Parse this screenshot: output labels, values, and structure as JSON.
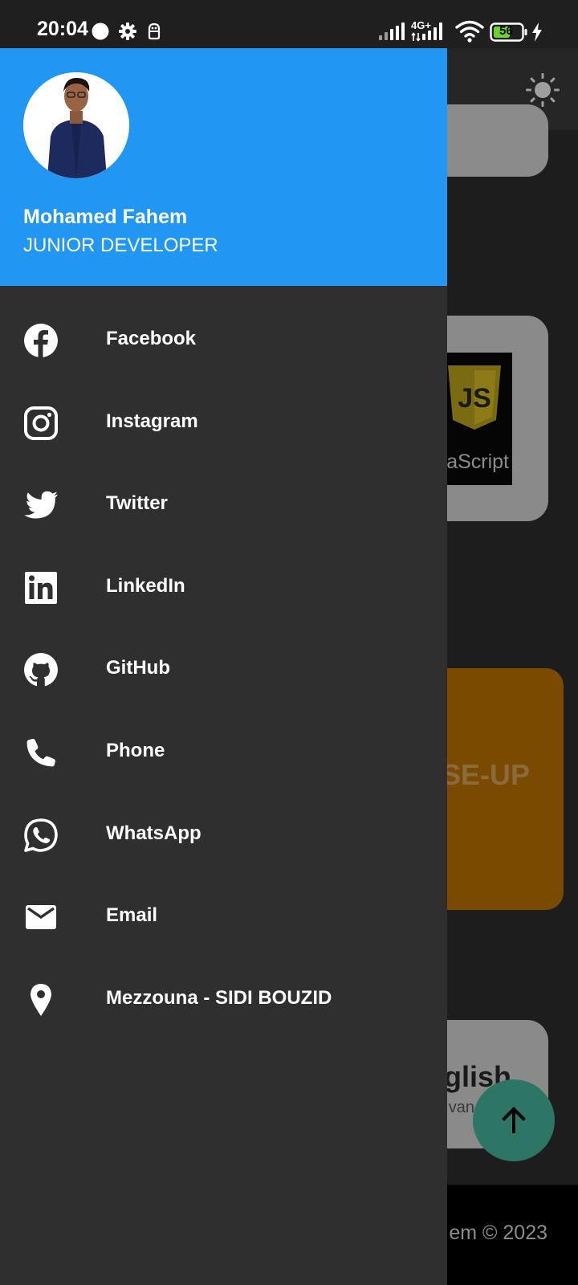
{
  "status_bar": {
    "time": "20:04",
    "network": "4G+",
    "battery": "56"
  },
  "drawer": {
    "user": {
      "name": "Mohamed Fahem",
      "role": "JUNIOR DEVELOPER"
    },
    "items": [
      {
        "label": "Facebook",
        "icon": "facebook-icon"
      },
      {
        "label": "Instagram",
        "icon": "instagram-icon"
      },
      {
        "label": "Twitter",
        "icon": "twitter-icon"
      },
      {
        "label": "LinkedIn",
        "icon": "linkedin-icon"
      },
      {
        "label": "GitHub",
        "icon": "github-icon"
      },
      {
        "label": "Phone",
        "icon": "phone-icon"
      },
      {
        "label": "WhatsApp",
        "icon": "whatsapp-icon"
      },
      {
        "label": "Email",
        "icon": "email-icon"
      },
      {
        "label": "Mezzouna - SIDI BOUZID",
        "icon": "location-icon"
      }
    ]
  },
  "background": {
    "js_card_label": "vaScript",
    "orange_card_text": "SE-UP",
    "english_card_title": "glish",
    "english_card_sub": "van",
    "footer_text": "em © 2023"
  },
  "colors": {
    "drawer_header": "#2196f3",
    "drawer_bg": "#2f2f2f",
    "fab": "#2d7565",
    "orange_card": "#7a4a00"
  }
}
